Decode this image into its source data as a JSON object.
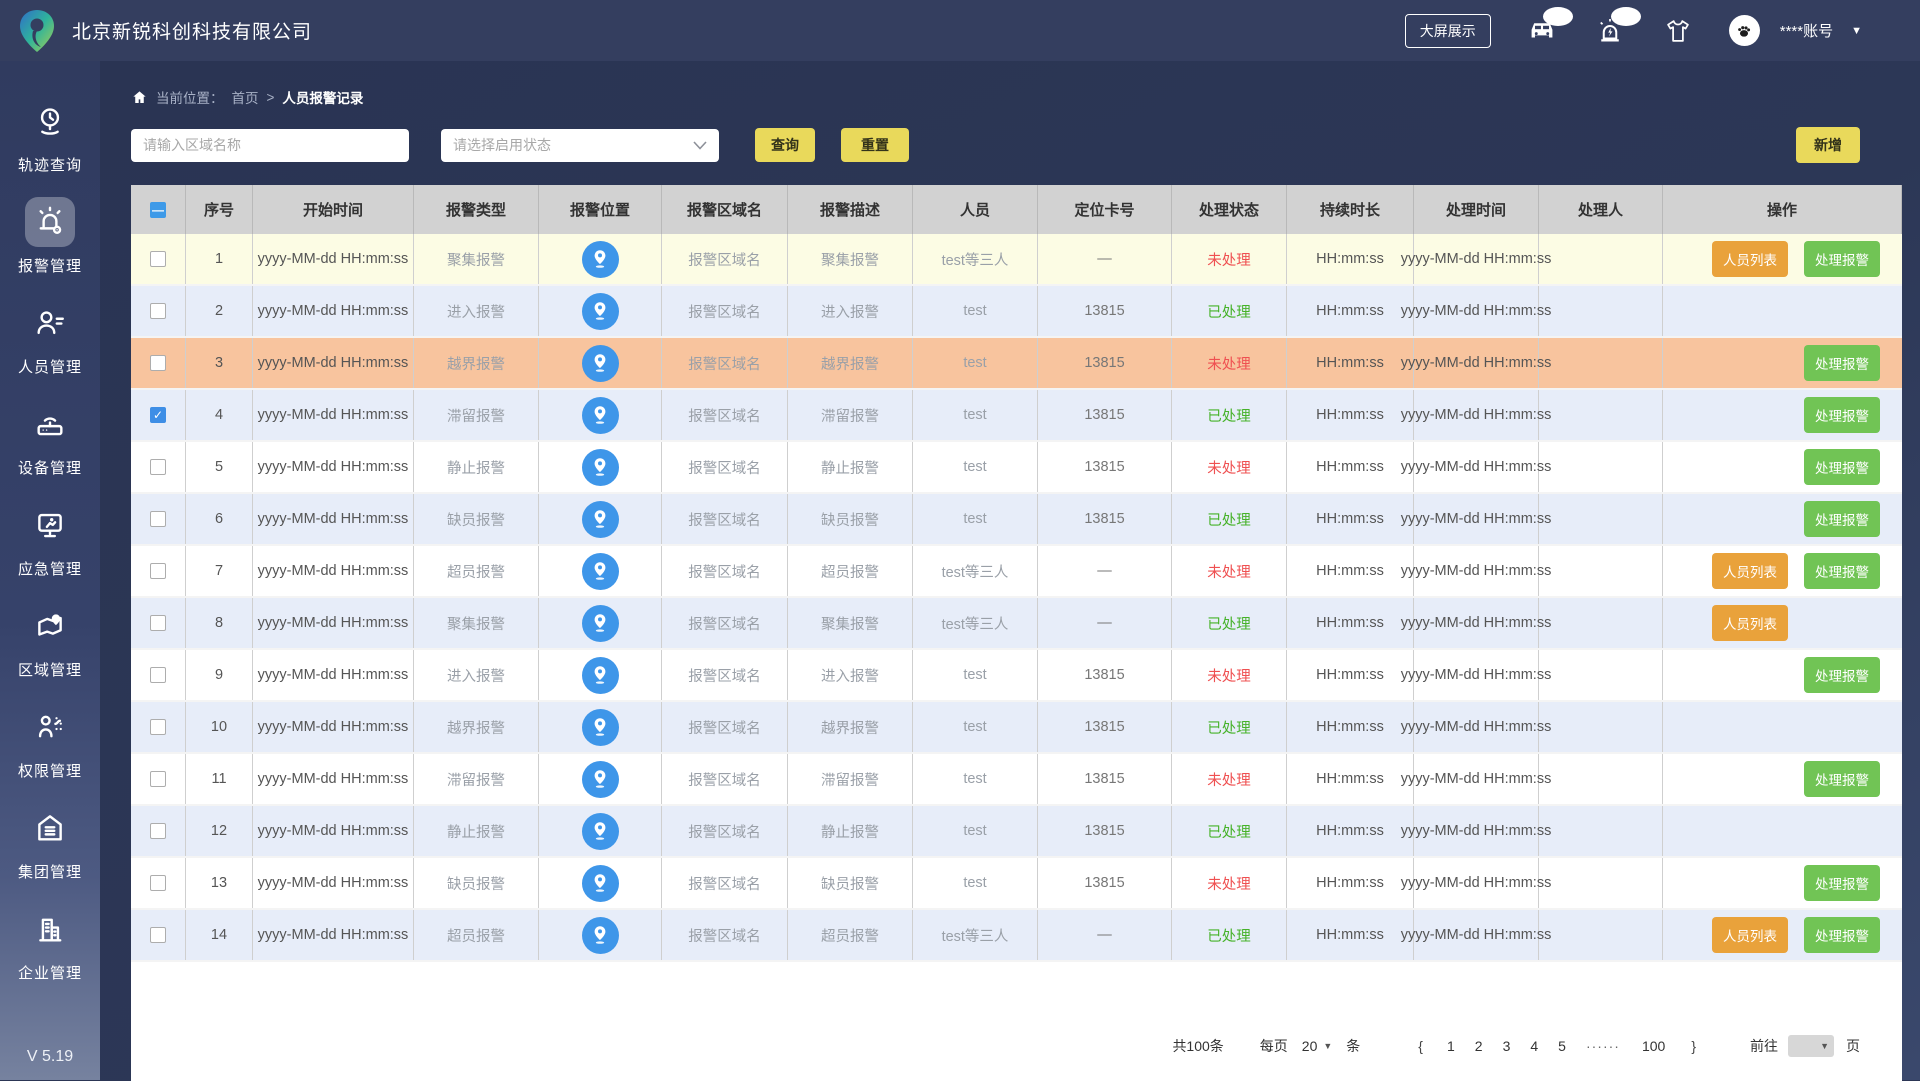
{
  "header": {
    "company": "北京新锐科创科技有限公司",
    "big_screen_label": "大屏展示",
    "account": "****账号"
  },
  "sidebar": {
    "items": [
      {
        "label": "轨迹查询",
        "icon": "track-icon",
        "active": false
      },
      {
        "label": "报警管理",
        "icon": "alarm-icon",
        "active": true
      },
      {
        "label": "人员管理",
        "icon": "person-icon",
        "active": false
      },
      {
        "label": "设备管理",
        "icon": "device-icon",
        "active": false
      },
      {
        "label": "应急管理",
        "icon": "emergency-icon",
        "active": false
      },
      {
        "label": "区域管理",
        "icon": "region-icon",
        "active": false
      },
      {
        "label": "权限管理",
        "icon": "permission-icon",
        "active": false
      },
      {
        "label": "集团管理",
        "icon": "group-icon",
        "active": false
      },
      {
        "label": "企业管理",
        "icon": "enterprise-icon",
        "active": false
      }
    ],
    "version": "V 5.19"
  },
  "breadcrumb": {
    "prefix": "当前位置：",
    "home": "首页",
    "separator": ">",
    "current": "人员报警记录"
  },
  "filters": {
    "area_placeholder": "请输入区域名称",
    "status_placeholder": "请选择启用状态",
    "query_label": "查询",
    "reset_label": "重置",
    "add_label": "新增"
  },
  "table": {
    "columns": [
      "",
      "序号",
      "开始时间",
      "报警类型",
      "报警位置",
      "报警区域名",
      "报警描述",
      "人员",
      "定位卡号",
      "处理状态",
      "持续时长",
      "处理时间",
      "处理人",
      "操作"
    ],
    "action_labels": {
      "person_list": "人员列表",
      "handle": "处理报警"
    },
    "header_checkbox": "indeterminate",
    "rows": [
      {
        "no": "1",
        "start": "yyyy-MM-dd HH:mm:ss",
        "type": "聚集报警",
        "area": "报警区域名",
        "desc": "聚集报警",
        "person": "test等三人",
        "card": "—",
        "status": "未处理",
        "duration": "HH:mm:ss",
        "handle_time": "yyyy-MM-dd HH:mm:ss",
        "handler": "",
        "actions": [
          "person_list",
          "handle"
        ],
        "style": "yellow",
        "checked": false
      },
      {
        "no": "2",
        "start": "yyyy-MM-dd HH:mm:ss",
        "type": "进入报警",
        "area": "报警区域名",
        "desc": "进入报警",
        "person": "test",
        "card": "13815",
        "status": "已处理",
        "duration": "HH:mm:ss",
        "handle_time": "yyyy-MM-dd HH:mm:ss",
        "handler": "",
        "actions": [],
        "style": "blue",
        "checked": false
      },
      {
        "no": "3",
        "start": "yyyy-MM-dd HH:mm:ss",
        "type": "越界报警",
        "area": "报警区域名",
        "desc": "越界报警",
        "person": "test",
        "card": "13815",
        "status": "未处理",
        "duration": "HH:mm:ss",
        "handle_time": "yyyy-MM-dd HH:mm:ss",
        "handler": "",
        "actions": [
          "handle"
        ],
        "style": "salmon",
        "checked": false
      },
      {
        "no": "4",
        "start": "yyyy-MM-dd HH:mm:ss",
        "type": "滞留报警",
        "area": "报警区域名",
        "desc": "滞留报警",
        "person": "test",
        "card": "13815",
        "status": "已处理",
        "duration": "HH:mm:ss",
        "handle_time": "yyyy-MM-dd HH:mm:ss",
        "handler": "",
        "actions": [
          "handle"
        ],
        "style": "blue",
        "checked": true
      },
      {
        "no": "5",
        "start": "yyyy-MM-dd HH:mm:ss",
        "type": "静止报警",
        "area": "报警区域名",
        "desc": "静止报警",
        "person": "test",
        "card": "13815",
        "status": "未处理",
        "duration": "HH:mm:ss",
        "handle_time": "yyyy-MM-dd HH:mm:ss",
        "handler": "",
        "actions": [
          "handle"
        ],
        "style": "white",
        "checked": false
      },
      {
        "no": "6",
        "start": "yyyy-MM-dd HH:mm:ss",
        "type": "缺员报警",
        "area": "报警区域名",
        "desc": "缺员报警",
        "person": "test",
        "card": "13815",
        "status": "已处理",
        "duration": "HH:mm:ss",
        "handle_time": "yyyy-MM-dd HH:mm:ss",
        "handler": "",
        "actions": [
          "handle"
        ],
        "style": "blue",
        "checked": false
      },
      {
        "no": "7",
        "start": "yyyy-MM-dd HH:mm:ss",
        "type": "超员报警",
        "area": "报警区域名",
        "desc": "超员报警",
        "person": "test等三人",
        "card": "—",
        "status": "未处理",
        "duration": "HH:mm:ss",
        "handle_time": "yyyy-MM-dd HH:mm:ss",
        "handler": "",
        "actions": [
          "person_list",
          "handle"
        ],
        "style": "white",
        "checked": false
      },
      {
        "no": "8",
        "start": "yyyy-MM-dd HH:mm:ss",
        "type": "聚集报警",
        "area": "报警区域名",
        "desc": "聚集报警",
        "person": "test等三人",
        "card": "—",
        "status": "已处理",
        "duration": "HH:mm:ss",
        "handle_time": "yyyy-MM-dd HH:mm:ss",
        "handler": "",
        "actions": [
          "person_list"
        ],
        "style": "blue",
        "checked": false
      },
      {
        "no": "9",
        "start": "yyyy-MM-dd HH:mm:ss",
        "type": "进入报警",
        "area": "报警区域名",
        "desc": "进入报警",
        "person": "test",
        "card": "13815",
        "status": "未处理",
        "duration": "HH:mm:ss",
        "handle_time": "yyyy-MM-dd HH:mm:ss",
        "handler": "",
        "actions": [
          "handle"
        ],
        "style": "white",
        "checked": false
      },
      {
        "no": "10",
        "start": "yyyy-MM-dd HH:mm:ss",
        "type": "越界报警",
        "area": "报警区域名",
        "desc": "越界报警",
        "person": "test",
        "card": "13815",
        "status": "已处理",
        "duration": "HH:mm:ss",
        "handle_time": "yyyy-MM-dd HH:mm:ss",
        "handler": "",
        "actions": [],
        "style": "blue",
        "checked": false
      },
      {
        "no": "11",
        "start": "yyyy-MM-dd HH:mm:ss",
        "type": "滞留报警",
        "area": "报警区域名",
        "desc": "滞留报警",
        "person": "test",
        "card": "13815",
        "status": "未处理",
        "duration": "HH:mm:ss",
        "handle_time": "yyyy-MM-dd HH:mm:ss",
        "handler": "",
        "actions": [
          "handle"
        ],
        "style": "white",
        "checked": false
      },
      {
        "no": "12",
        "start": "yyyy-MM-dd HH:mm:ss",
        "type": "静止报警",
        "area": "报警区域名",
        "desc": "静止报警",
        "person": "test",
        "card": "13815",
        "status": "已处理",
        "duration": "HH:mm:ss",
        "handle_time": "yyyy-MM-dd HH:mm:ss",
        "handler": "",
        "actions": [],
        "style": "blue",
        "checked": false
      },
      {
        "no": "13",
        "start": "yyyy-MM-dd HH:mm:ss",
        "type": "缺员报警",
        "area": "报警区域名",
        "desc": "缺员报警",
        "person": "test",
        "card": "13815",
        "status": "未处理",
        "duration": "HH:mm:ss",
        "handle_time": "yyyy-MM-dd HH:mm:ss",
        "handler": "",
        "actions": [
          "handle"
        ],
        "style": "white",
        "checked": false
      },
      {
        "no": "14",
        "start": "yyyy-MM-dd HH:mm:ss",
        "type": "超员报警",
        "area": "报警区域名",
        "desc": "超员报警",
        "person": "test等三人",
        "card": "—",
        "status": "已处理",
        "duration": "HH:mm:ss",
        "handle_time": "yyyy-MM-dd HH:mm:ss",
        "handler": "",
        "actions": [
          "person_list",
          "handle"
        ],
        "style": "blue",
        "checked": false
      }
    ]
  },
  "pagination": {
    "total": "共100条",
    "per_page_label": "每页",
    "per_page_value": "20",
    "unit_label": "条",
    "prev": "{",
    "pages": [
      "1",
      "2",
      "3",
      "4",
      "5"
    ],
    "ellipsis": "······",
    "last_page": "100",
    "next": "}",
    "goto_label": "前往",
    "page_label": "页"
  },
  "colors": {
    "topbar": "#343e5f",
    "accent_yellow": "#e9d95b",
    "btn_orange": "#e9a23b",
    "btn_green": "#71c455",
    "status_red": "#ef5051",
    "status_green": "#46b229",
    "pin_blue": "#3e96e9",
    "row_yellow": "#fcfce4",
    "row_blue": "#e7edf9",
    "row_salmon": "#f8c49e"
  }
}
